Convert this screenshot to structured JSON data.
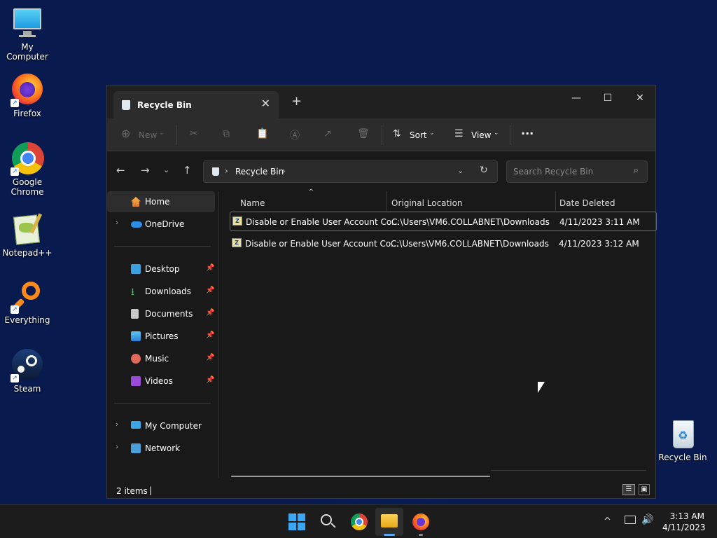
{
  "desktop": {
    "icons": [
      {
        "label": "My Computer",
        "icon": "monitor-icon"
      },
      {
        "label": "Firefox",
        "icon": "firefox-icon"
      },
      {
        "label": "Google Chrome",
        "icon": "chrome-icon"
      },
      {
        "label": "Notepad++",
        "icon": "notepadpp-icon"
      },
      {
        "label": "Everything",
        "icon": "everything-icon"
      },
      {
        "label": "Steam",
        "icon": "steam-icon"
      }
    ],
    "recycle_bin_label": "Recycle Bin"
  },
  "window": {
    "tab_title": "Recycle Bin",
    "toolbar": {
      "new_label": "New",
      "sort_label": "Sort",
      "view_label": "View",
      "more_label": "···"
    },
    "address": {
      "breadcrumb": "Recycle Bin",
      "search_placeholder": "Search Recycle Bin"
    },
    "sidebar": {
      "top": [
        {
          "label": "Home",
          "icon": "home-icon"
        },
        {
          "label": "OneDrive",
          "icon": "cloud-icon"
        }
      ],
      "pinned": [
        {
          "label": "Desktop",
          "icon": "desktop-folder-icon"
        },
        {
          "label": "Downloads",
          "icon": "download-icon"
        },
        {
          "label": "Documents",
          "icon": "documents-icon"
        },
        {
          "label": "Pictures",
          "icon": "pictures-icon"
        },
        {
          "label": "Music",
          "icon": "music-icon"
        },
        {
          "label": "Videos",
          "icon": "videos-icon"
        }
      ],
      "bottom": [
        {
          "label": "My Computer",
          "icon": "monitor-icon"
        },
        {
          "label": "Network",
          "icon": "network-icon"
        }
      ]
    },
    "columns": {
      "name": "Name",
      "original_location": "Original Location",
      "date_deleted": "Date Deleted"
    },
    "rows": [
      {
        "name": "Disable or Enable User Account Co...",
        "location": "C:\\Users\\VM6.COLLABNET\\Downloads",
        "date": "4/11/2023 3:11 AM"
      },
      {
        "name": "Disable or Enable User Account Co...",
        "location": "C:\\Users\\VM6.COLLABNET\\Downloads",
        "date": "4/11/2023 3:12 AM"
      }
    ],
    "status": {
      "items": "2 items",
      "cursor": "|"
    }
  },
  "taskbar": {
    "time": "3:13 AM",
    "date": "4/11/2023",
    "caret": "^"
  }
}
